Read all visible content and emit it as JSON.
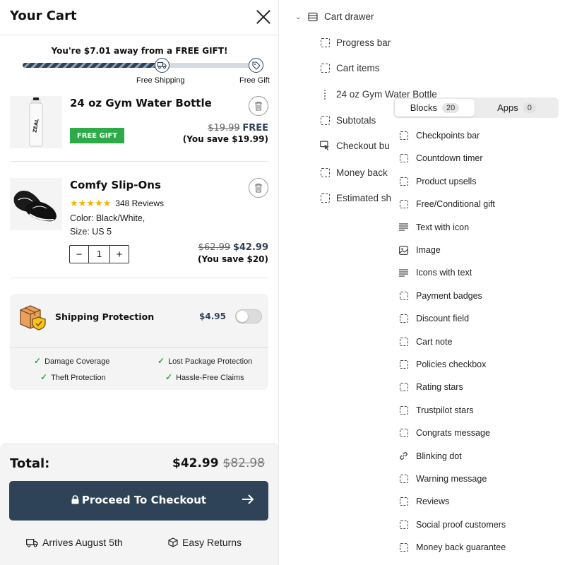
{
  "cart": {
    "title": "Your Cart",
    "gift_message": "You're $7.01 away from a FREE GIFT!",
    "progress": {
      "fill_fraction": 0.6,
      "free_shipping_label": "Free Shipping",
      "free_gift_label": "Free Gift"
    },
    "items": [
      {
        "name": "24 oz Gym Water Bottle",
        "badge": "FREE GIFT",
        "old_price": "$19.99",
        "new_price": "FREE",
        "save_text": "(You save $19.99)"
      },
      {
        "name": "Comfy Slip-Ons",
        "stars": "★★★★★",
        "reviews": "348 Reviews",
        "color_text": "Color: Black/White,",
        "size_text": "Size: US 5",
        "qty_minus": "−",
        "qty": "1",
        "qty_plus": "+",
        "old_price": "$62.99",
        "new_price": "$42.99",
        "save_text": "(You save $20)"
      }
    ],
    "protection": {
      "title": "Shipping Protection",
      "price": "$4.95",
      "enabled": false,
      "features": [
        "Damage Coverage",
        "Lost Package Protection",
        "Theft Protection",
        "Hassle-Free Claims"
      ],
      "check": "✓"
    },
    "footer": {
      "total_label": "Total:",
      "total": "$42.99",
      "total_old": "$82.98",
      "checkout_label": "Proceed To Checkout",
      "arrives": "Arrives August 5th",
      "returns": "Easy Returns"
    },
    "colors": {
      "brand": "#2f4358",
      "gift_green": "#2eab49",
      "stars": "#f5b301"
    }
  },
  "editor": {
    "tree_root": "Cart drawer",
    "tree_items": [
      {
        "label": "Progress bar",
        "icon": "dashed-box-icon"
      },
      {
        "label": "Cart items",
        "icon": "dashed-box-icon"
      },
      {
        "label": "24 oz Gym Water Bottle",
        "icon": "dotted-line-icon"
      },
      {
        "label": "Subtotals",
        "icon": "dashed-box-icon"
      },
      {
        "label": "Checkout bu",
        "icon": "cursor-box-icon"
      },
      {
        "label": "Money back",
        "icon": "dashed-box-icon"
      },
      {
        "label": "Estimated sh",
        "icon": "dashed-box-icon"
      }
    ],
    "tabs": [
      {
        "label": "Blocks",
        "count": "20",
        "active": true
      },
      {
        "label": "Apps",
        "count": "0",
        "active": false
      }
    ],
    "blocks": [
      {
        "label": "Checkpoints bar",
        "icon": "dashed-box-icon"
      },
      {
        "label": "Countdown timer",
        "icon": "dashed-box-icon"
      },
      {
        "label": "Product upsells",
        "icon": "dashed-box-icon"
      },
      {
        "label": "Free/Conditional gift",
        "icon": "dashed-box-icon"
      },
      {
        "label": "Text with icon",
        "icon": "text-lines-icon"
      },
      {
        "label": "Image",
        "icon": "image-icon"
      },
      {
        "label": "Icons with text",
        "icon": "text-lines-icon"
      },
      {
        "label": "Payment badges",
        "icon": "dashed-box-icon"
      },
      {
        "label": "Discount field",
        "icon": "dashed-box-icon"
      },
      {
        "label": "Cart note",
        "icon": "dashed-box-icon"
      },
      {
        "label": "Policies checkbox",
        "icon": "dashed-box-icon"
      },
      {
        "label": "Rating stars",
        "icon": "dashed-box-icon"
      },
      {
        "label": "Trustpilot stars",
        "icon": "dashed-box-icon"
      },
      {
        "label": "Congrats message",
        "icon": "dashed-box-icon"
      },
      {
        "label": "Blinking dot",
        "icon": "link-icon"
      },
      {
        "label": "Warning message",
        "icon": "dashed-box-icon"
      },
      {
        "label": "Reviews",
        "icon": "dashed-box-icon"
      },
      {
        "label": "Social proof customers",
        "icon": "dashed-box-icon"
      },
      {
        "label": "Money back guarantee",
        "icon": "dashed-box-icon"
      }
    ]
  }
}
